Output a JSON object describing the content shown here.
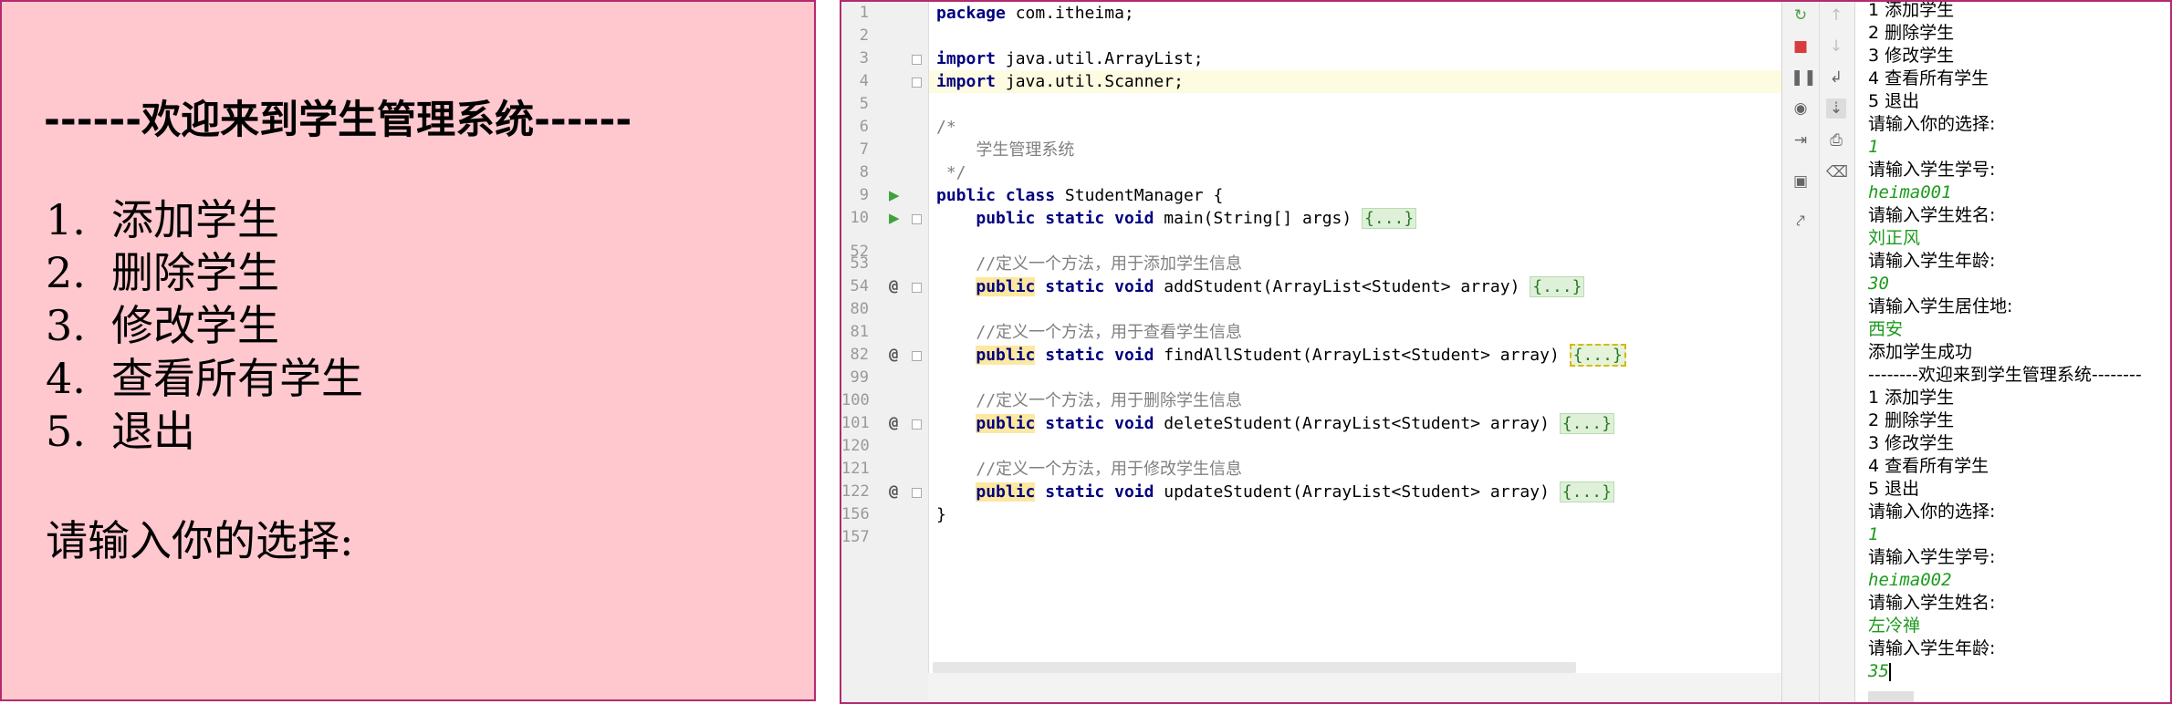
{
  "slide": {
    "title": "------欢迎来到学生管理系统------",
    "menu": [
      {
        "num": "1.",
        "label": "添加学生"
      },
      {
        "num": "2.",
        "label": "删除学生"
      },
      {
        "num": "3.",
        "label": "修改学生"
      },
      {
        "num": "4.",
        "label": "查看所有学生"
      },
      {
        "num": "5.",
        "label": "退出"
      }
    ],
    "prompt": "请输入你的选择:"
  },
  "editor": {
    "line_numbers": [
      "1",
      "2",
      "3",
      "4",
      "5",
      "6",
      "7",
      "8",
      "9",
      "10",
      "52",
      "53",
      "54",
      "80",
      "81",
      "82",
      "99",
      "100",
      "101",
      "120",
      "121",
      "122",
      "156",
      "157"
    ],
    "code": {
      "l1_kw": "package",
      "l1_rest": " com.itheima;",
      "l3_kw": "import",
      "l3_rest": " java.util.ArrayList;",
      "l4_kw": "import",
      "l4_rest": " java.util.Scanner;",
      "l6": "/*",
      "l7": "    学生管理系统",
      "l8": " */",
      "l9_kw1": "public",
      "l9_kw2": "class",
      "l9_rest": " StudentManager {",
      "l10_kw1": "public",
      "l10_kw2": "static",
      "l10_kw3": "void",
      "l10_rest": " main(String[] args) ",
      "l53": "//定义一个方法，用于添加学生信息",
      "l54_rest": " addStudent(ArrayList<Student> array) ",
      "l81": "//定义一个方法，用于查看学生信息",
      "l82_rest": " findAllStudent(ArrayList<Student> array) ",
      "l100": "//定义一个方法，用于删除学生信息",
      "l101_rest": " deleteStudent(ArrayList<Student> array) ",
      "l121": "//定义一个方法，用于修改学生信息",
      "l122_rest": " updateStudent(ArrayList<Student> array) ",
      "l156": "}",
      "kw_public": "public",
      "kw_static": "static",
      "kw_void": "void",
      "fold": "{...}"
    }
  },
  "console": {
    "lines": [
      {
        "text": "1 添加学生",
        "kind": "out"
      },
      {
        "text": "2 删除学生",
        "kind": "out"
      },
      {
        "text": "3 修改学生",
        "kind": "out"
      },
      {
        "text": "4 查看所有学生",
        "kind": "out"
      },
      {
        "text": "5 退出",
        "kind": "out"
      },
      {
        "text": "请输入你的选择:",
        "kind": "out"
      },
      {
        "text": "1",
        "kind": "in"
      },
      {
        "text": "请输入学生学号:",
        "kind": "out"
      },
      {
        "text": "heima001",
        "kind": "in"
      },
      {
        "text": "请输入学生姓名:",
        "kind": "out"
      },
      {
        "text": "刘正风",
        "kind": "in-cjk"
      },
      {
        "text": "请输入学生年龄:",
        "kind": "out"
      },
      {
        "text": "30",
        "kind": "in"
      },
      {
        "text": "请输入学生居住地:",
        "kind": "out"
      },
      {
        "text": "西安",
        "kind": "in-cjk"
      },
      {
        "text": "添加学生成功",
        "kind": "out"
      },
      {
        "text": "--------欢迎来到学生管理系统--------",
        "kind": "out"
      },
      {
        "text": "1 添加学生",
        "kind": "out"
      },
      {
        "text": "2 删除学生",
        "kind": "out"
      },
      {
        "text": "3 修改学生",
        "kind": "out"
      },
      {
        "text": "4 查看所有学生",
        "kind": "out"
      },
      {
        "text": "5 退出",
        "kind": "out"
      },
      {
        "text": "请输入你的选择:",
        "kind": "out"
      },
      {
        "text": "1",
        "kind": "in"
      },
      {
        "text": "请输入学生学号:",
        "kind": "out"
      },
      {
        "text": "heima002",
        "kind": "in"
      },
      {
        "text": "请输入学生姓名:",
        "kind": "out"
      },
      {
        "text": "左冷禅",
        "kind": "in-cjk"
      },
      {
        "text": "请输入学生年龄:",
        "kind": "out"
      },
      {
        "text": "35",
        "kind": "in"
      }
    ]
  },
  "icons": {
    "rerun": "rerun-icon",
    "stop": "stop-icon",
    "pause": "pause-icon",
    "camera": "dump-threads-icon",
    "exit": "exit-icon",
    "layout": "layout-icon",
    "pin": "pin-icon",
    "up": "up-arrow-icon",
    "down": "down-arrow-icon",
    "wrap": "soft-wrap-icon",
    "scroll": "scroll-to-end-icon",
    "print": "print-icon",
    "trash": "clear-all-icon"
  }
}
